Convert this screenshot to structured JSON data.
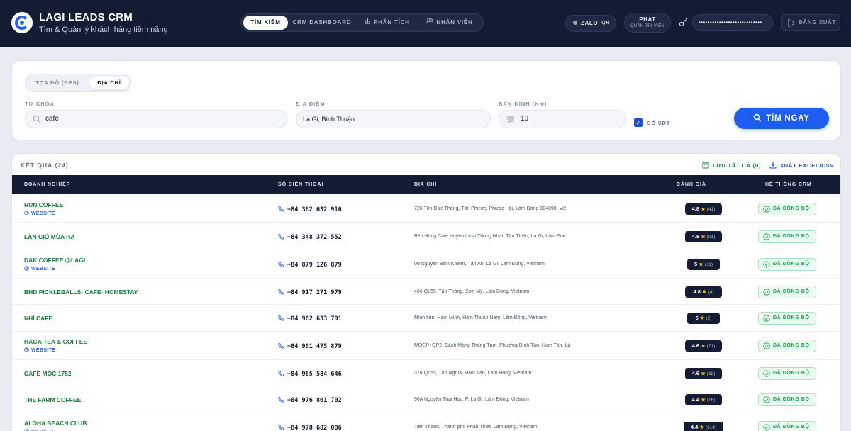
{
  "header": {
    "brand_title": "LAGI LEADS CRM",
    "brand_subtitle": "Tìm & Quản lý khách hàng tiềm năng",
    "nav": [
      {
        "label": "TÌM KIẾM",
        "active": true
      },
      {
        "label": "CRM DASHBOARD",
        "active": false
      },
      {
        "label": "PHÂN TÍCH",
        "active": false,
        "icon": "bar-chart-icon"
      },
      {
        "label": "NHÂN VIÊN",
        "active": false,
        "icon": "users-icon"
      }
    ],
    "zalo_label": "ZALO",
    "zalo_qr": "QR",
    "user_name": "PHAT",
    "user_role": "QUẢN TRỊ VIÊN",
    "password_mask": "••••••••••••••••••••••••••••",
    "logout_label": "ĐĂNG XUẤT"
  },
  "search": {
    "modes": [
      "TỌA ĐỘ (GPS)",
      "ĐỊA CHỈ"
    ],
    "active_mode": "ĐỊA CHỈ",
    "keyword_label": "TỪ KHÓA",
    "keyword_value": "cafe",
    "location_label": "ĐỊA ĐIỂM",
    "location_value": "La Gi, Bình Thuận",
    "radius_label": "BÁN KÍNH (KM)",
    "radius_value": "10",
    "has_phone_label": "CÓ SĐT",
    "has_phone_checked": true,
    "submit_label": "TÌM NGAY"
  },
  "results": {
    "title": "KẾT QUẢ (24)",
    "save_all_label": "LƯU TẤT CẢ (0)",
    "export_label": "XUẤT EXCEL/CSV",
    "columns": [
      "DOANH NGHIỆP",
      "SỐ ĐIỆN THOẠI",
      "ĐỊA CHỈ",
      "ĐÁNH GIÁ",
      "HỆ THỐNG CRM"
    ],
    "website_label": "WEBSITE",
    "crm_status": "ĐÃ ĐỒNG BỘ",
    "rows": [
      {
        "name": "RUN COFFEE",
        "website": true,
        "phone": "+84 362 632 916",
        "address": "726 Tôn Đức Thắng, Tân Phước, Phước Hội, Lâm Đồng 804890, Việ",
        "rating": "4.8",
        "reviews": "(41)"
      },
      {
        "name": "LÀN GIÓ MÙA HẠ",
        "website": false,
        "phone": "+84 348 372 552",
        "address": "Bên Hông Cafe Huyền thoại Thống Nhất, Tân Thiện, La Gi, Lâm Đồn",
        "rating": "4.8",
        "reviews": "(91)"
      },
      {
        "name": "DAK COFFEE @LAGI",
        "website": true,
        "phone": "+84 879 126 879",
        "address": "09 Nguyễn Bỉnh Khiêm, Tân An, La Gi, Lâm Đồng, Vietnam",
        "rating": "5",
        "reviews": "(11)"
      },
      {
        "name": "BHD PICKLEBALLS- CAFE- HOMESTAY",
        "website": false,
        "phone": "+84 917 271 979",
        "address": "466 QL55, Tân Thắng, Sơn Mỹ, Lâm Đồng, Vietnam",
        "rating": "4.8",
        "reviews": "(4)"
      },
      {
        "name": "NHÍ CAFE",
        "website": false,
        "phone": "+84 962 633 791",
        "address": "Minh tiến, Hàm Minh, Hàm Thuận Nam, Lâm Đồng, Vietnam",
        "rating": "5",
        "reviews": "(2)"
      },
      {
        "name": "HAGA TEA & COFFEE",
        "website": true,
        "phone": "+84 901 475 879",
        "address": "MQCP+QP2, Cách Mạng Tháng Tám, Phường Bình Tân, Hàm Tân, Lâ",
        "rating": "4.6",
        "reviews": "(71)"
      },
      {
        "name": "CAFE MỘC 1752",
        "website": false,
        "phone": "+84 965 584 646",
        "address": "376 QL55, Tân Nghĩa, Hàm Tân, Lâm Đồng, Vietnam",
        "rating": "4.6",
        "reviews": "(18)"
      },
      {
        "name": "THE FARM COFFEE",
        "website": false,
        "phone": "+84 976 801 702",
        "address": "96A Nguyễn Thái Học, P, La Gi, Lâm Đồng, Vietnam",
        "rating": "4.4",
        "reviews": "(16)"
      },
      {
        "name": "ALOHA BEACH CLUB",
        "website": true,
        "phone": "+84 978 682 086",
        "address": "Tiến Thành, Thành phố Phan Thiết, Lâm Đồng, Vietnam",
        "rating": "4.4",
        "reviews": "(614)"
      }
    ]
  }
}
